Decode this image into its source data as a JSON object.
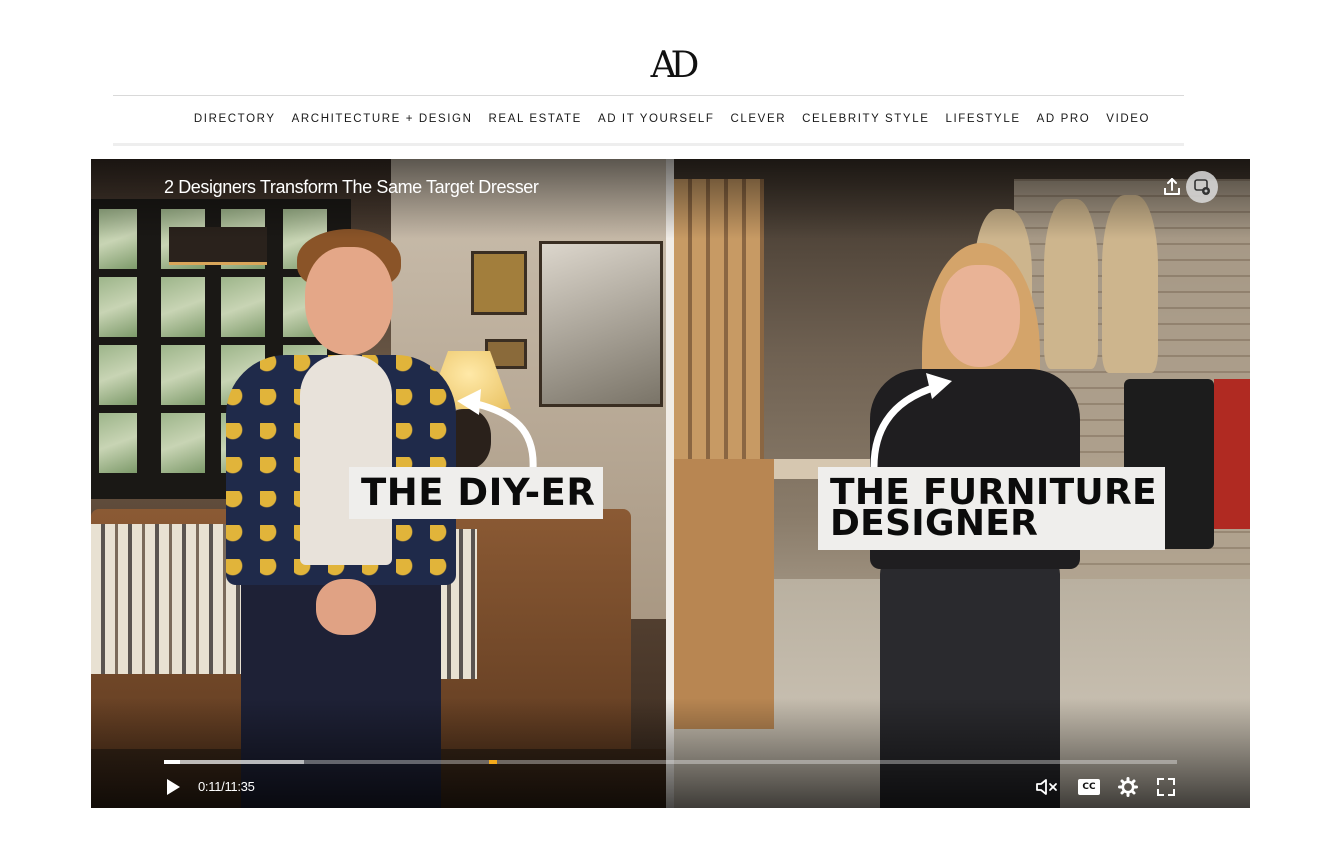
{
  "site": {
    "logo_text": "AD"
  },
  "nav": {
    "items": [
      {
        "label": "DIRECTORY"
      },
      {
        "label": "ARCHITECTURE + DESIGN"
      },
      {
        "label": "REAL ESTATE"
      },
      {
        "label": "AD IT YOURSELF"
      },
      {
        "label": "CLEVER"
      },
      {
        "label": "CELEBRITY STYLE"
      },
      {
        "label": "LIFESTYLE"
      },
      {
        "label": "AD PRO"
      },
      {
        "label": "VIDEO"
      }
    ]
  },
  "video": {
    "title": "2 Designers Transform The Same Target Dresser",
    "overlay_left": "THE DIY-ER",
    "overlay_right_line1": "THE FURNITURE",
    "overlay_right_line2": "DESIGNER",
    "time_display": "0:11/11:35",
    "progress_fraction": 0.0158,
    "buffered_fraction": 0.138,
    "marker_fraction": 0.321,
    "icons": {
      "share": "share-icon",
      "cast": "cast-icon",
      "play": "play-icon",
      "mute": "volume-muted-icon",
      "cc": "closed-captions-icon",
      "settings": "gear-icon",
      "fullscreen": "fullscreen-icon"
    },
    "cc_label": "CC",
    "accent_color": "#f3a91b"
  }
}
